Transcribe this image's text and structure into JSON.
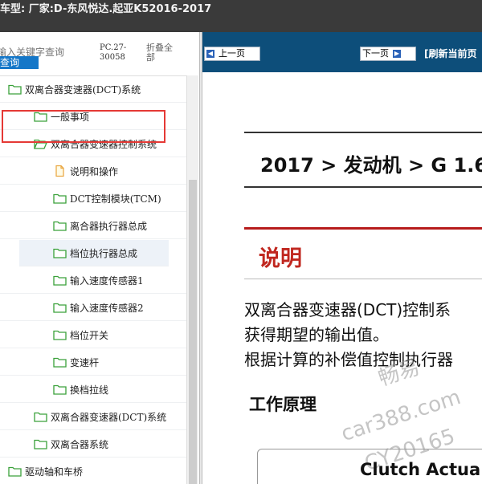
{
  "header": {
    "title": "车型:  厂家:D-东风悦达.起亚K52016-2017"
  },
  "search": {
    "placeholder": "输入关键字查询",
    "button_label": "查询",
    "pc_code": "PC.27-30058",
    "collapse_label": "折叠全部"
  },
  "tree": [
    {
      "label": "双离合器变速器(DCT)系统",
      "icon": "folder-icon",
      "selected": false
    },
    {
      "label": "一般事项",
      "icon": "folder-icon",
      "selected": false
    },
    {
      "label": "双离合器变速器控制系统",
      "icon": "folder-icon",
      "selected": false
    },
    {
      "label": "说明和操作",
      "icon": "document-icon",
      "selected": false
    },
    {
      "label": "DCT控制模块(TCM)",
      "icon": "folder-icon",
      "selected": false
    },
    {
      "label": "离合器执行器总成",
      "icon": "folder-icon",
      "selected": false
    },
    {
      "label": "档位执行器总成",
      "icon": "folder-icon",
      "selected": true
    },
    {
      "label": "输入速度传感器1",
      "icon": "folder-icon",
      "selected": false
    },
    {
      "label": "输入速度传感器2",
      "icon": "folder-icon",
      "selected": false
    },
    {
      "label": "档位开关",
      "icon": "folder-icon",
      "selected": false
    },
    {
      "label": "变速杆",
      "icon": "folder-icon",
      "selected": false
    },
    {
      "label": "换档拉线",
      "icon": "folder-icon",
      "selected": false
    },
    {
      "label": "双离合器变速器(DCT)系统",
      "icon": "folder-icon",
      "selected": false
    },
    {
      "label": "双离合器系统",
      "icon": "folder-icon",
      "selected": false
    },
    {
      "label": "驱动轴和车桥",
      "icon": "folder-icon",
      "selected": false
    }
  ],
  "nav": {
    "prev_label": "上一页",
    "next_label": "下一页",
    "refresh_label": "[刷新当前页"
  },
  "content": {
    "breadcrumb": "2017 > 发动机 > G 1.6",
    "section_title": "说明",
    "lines": [
      "双离合器变速器(DCT)控制系",
      "获得期望的输出值。",
      "根据计算的补偿值控制执行器"
    ],
    "subheading": "工作原理",
    "box_title": "Clutch Actua"
  },
  "watermark": {
    "line1": "畅易",
    "line2": "car388.com",
    "line3": "CY20165"
  },
  "colors": {
    "nav_bg": "#0d4e7a",
    "section_red": "#c0271f",
    "highlight_red": "#e53935",
    "search_button": "#1577c8"
  }
}
